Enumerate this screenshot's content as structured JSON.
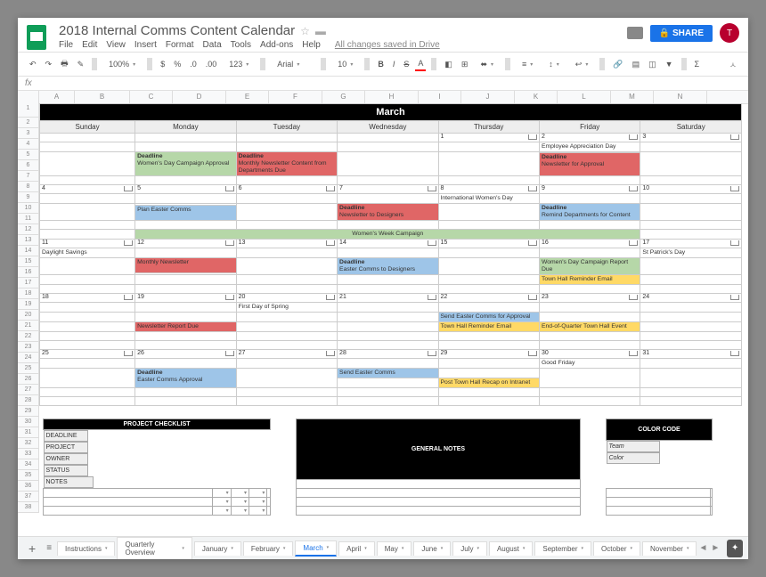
{
  "doc": {
    "title": "2018 Internal Comms Content Calendar",
    "saved_msg": "All changes saved in Drive",
    "avatar_letter": "T",
    "share_label": "SHARE"
  },
  "menu": [
    "File",
    "Edit",
    "View",
    "Insert",
    "Format",
    "Data",
    "Tools",
    "Add-ons",
    "Help"
  ],
  "toolbar": {
    "zoom": "100%",
    "currency": "$",
    "percent": "%",
    "dec_dec": ".0",
    "dec_inc": ".00",
    "more_formats": "123",
    "font": "Arial",
    "size": "10"
  },
  "columns": [
    "A",
    "B",
    "C",
    "D",
    "E",
    "F",
    "G",
    "H",
    "I",
    "J",
    "K",
    "L",
    "M",
    "N"
  ],
  "month": "March",
  "days": [
    "Sunday",
    "Monday",
    "Tuesday",
    "Wednesday",
    "Thursday",
    "Friday",
    "Saturday"
  ],
  "week1": {
    "dates": [
      "",
      "",
      "",
      "",
      "1",
      "2",
      "3"
    ],
    "events": {
      "fri_note": "Employee Appreciation Day",
      "mon_deadline": "Deadline",
      "mon_text": "Women's Day Campaign Approval",
      "tue_deadline": "Deadline",
      "tue_text": "Monthly Newsletter Content from Departments Due",
      "fri_deadline": "Deadline",
      "fri_text": "Newsletter for Approval"
    }
  },
  "week2": {
    "dates": [
      "4",
      "5",
      "6",
      "7",
      "8",
      "9",
      "10"
    ],
    "events": {
      "thu_note": "International Women's Day",
      "mon_blue": "Plan Easter Comms",
      "wed_deadline": "Deadline",
      "wed_text": "Newsletter to Designers",
      "fri_deadline": "Deadline",
      "fri_text": "Remind Departments for Content",
      "span_green": "Women's Week Campaign"
    }
  },
  "week3": {
    "dates": [
      "11",
      "12",
      "13",
      "14",
      "15",
      "16",
      "17"
    ],
    "events": {
      "sun_note": "Daylight Savings",
      "sat_note": "St Patrick's Day",
      "mon_red": "Monthly Newsletter",
      "wed_deadline": "Deadline",
      "wed_text": "Easter Comms to Designers",
      "fri_green": "Women's Day Campaign Report Due",
      "fri_yellow": "Town Hall Reminder Email"
    }
  },
  "week4": {
    "dates": [
      "18",
      "19",
      "20",
      "21",
      "22",
      "23",
      "24"
    ],
    "events": {
      "tue_note": "First Day of Spring",
      "mon_red": "Newsletter Report Due",
      "thu_blue": "Send Easter Comms for Approval",
      "thu_yellow": "Town Hall Reminder Email",
      "fri_yellow": "End-of-Quarter Town Hall Event"
    }
  },
  "week5": {
    "dates": [
      "25",
      "26",
      "27",
      "28",
      "29",
      "30",
      "31"
    ],
    "events": {
      "fri_note": "Good Friday",
      "mon_deadline": "Deadline",
      "mon_text": "Easter Comms Approval",
      "wed_blue": "Send Easter Comms",
      "thu_yellow": "Post Town Hall Recap on Intranet"
    }
  },
  "checklist": {
    "title": "PROJECT CHECKLIST",
    "headers": [
      "DEADLINE",
      "PROJECT",
      "OWNER",
      "STATUS",
      "NOTES"
    ]
  },
  "notes": {
    "title": "GENERAL NOTES"
  },
  "colorcode": {
    "title": "COLOR CODE",
    "headers": [
      "Team",
      "Color"
    ]
  },
  "tabs": [
    "Instructions",
    "Quarterly Overview",
    "January",
    "February",
    "March",
    "April",
    "May",
    "June",
    "July",
    "August",
    "September",
    "October",
    "November"
  ],
  "active_tab": "March"
}
